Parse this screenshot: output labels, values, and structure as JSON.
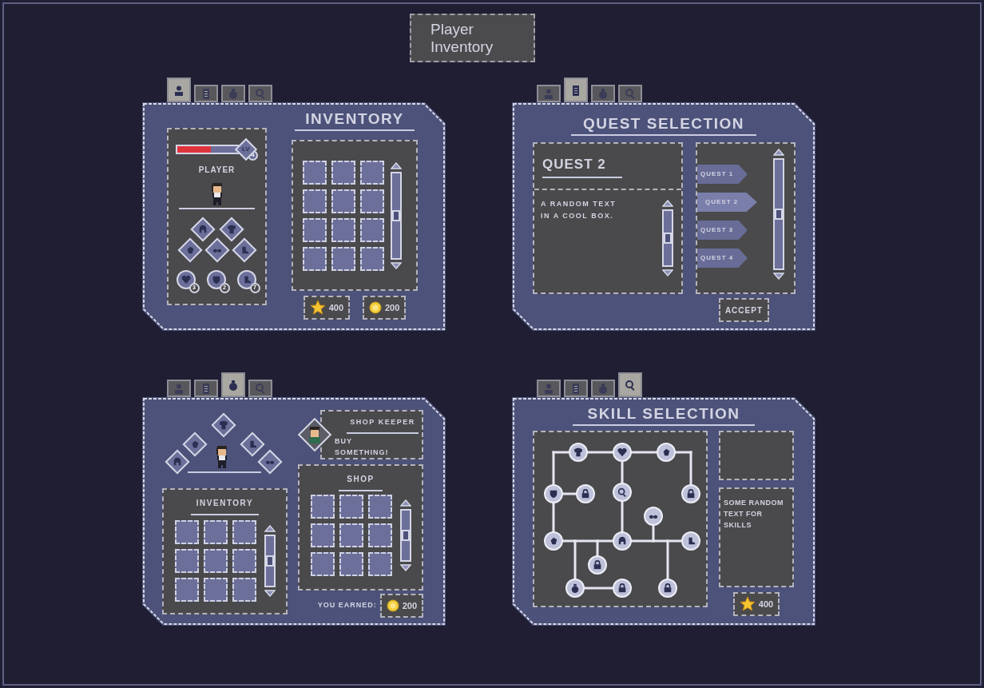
{
  "title": "Player Inventory",
  "panels": [
    {
      "kind": "inventory",
      "tabs": [
        {
          "selected": true
        },
        {
          "selected": false
        },
        {
          "selected": false
        },
        {
          "selected": false
        }
      ],
      "heading": "INVENTORY",
      "player": {
        "health": {
          "level": 0.55
        },
        "lv_label": "LV",
        "lv_value": "4",
        "name": "PLAYER"
      },
      "stats": [
        {
          "count": "3"
        },
        {
          "count": "2"
        },
        {
          "count": "7"
        }
      ],
      "currencies": [
        {
          "kind": "star",
          "amount": "400"
        },
        {
          "kind": "coin",
          "amount": "200"
        }
      ]
    },
    {
      "kind": "quest",
      "tabs": [
        {
          "selected": false
        },
        {
          "selected": true
        },
        {
          "selected": false
        },
        {
          "selected": false
        }
      ],
      "heading": "QUEST SELECTION",
      "detail_title": "QUEST 2",
      "description": "A RANDOM TEXT IN A COOL BOX.",
      "quests": [
        {
          "label": "QUEST 1",
          "selected": false
        },
        {
          "label": "QUEST 2",
          "selected": true
        },
        {
          "label": "QUEST 3",
          "selected": false
        },
        {
          "label": "QUEST 4",
          "selected": false
        }
      ],
      "accept_button": "ACCEPT"
    },
    {
      "kind": "shop",
      "tabs": [
        {
          "selected": false
        },
        {
          "selected": false
        },
        {
          "selected": true
        },
        {
          "selected": false
        }
      ],
      "keeper": {
        "title": "SHOP KEEPER",
        "speech": "BUY SOMETHING!"
      },
      "inventory_heading": "INVENTORY",
      "shop_heading": "SHOP",
      "earned_label": "YOU EARNED:",
      "earned": {
        "kind": "coin",
        "amount": "200"
      }
    },
    {
      "kind": "skill",
      "tabs": [
        {
          "selected": false
        },
        {
          "selected": false
        },
        {
          "selected": false
        },
        {
          "selected": true
        }
      ],
      "heading": "SKILL SELECTION",
      "skill_text": "SOME RANDOM TEXT FOR SKILLS",
      "currency": {
        "kind": "star",
        "amount": "400"
      }
    }
  ]
}
